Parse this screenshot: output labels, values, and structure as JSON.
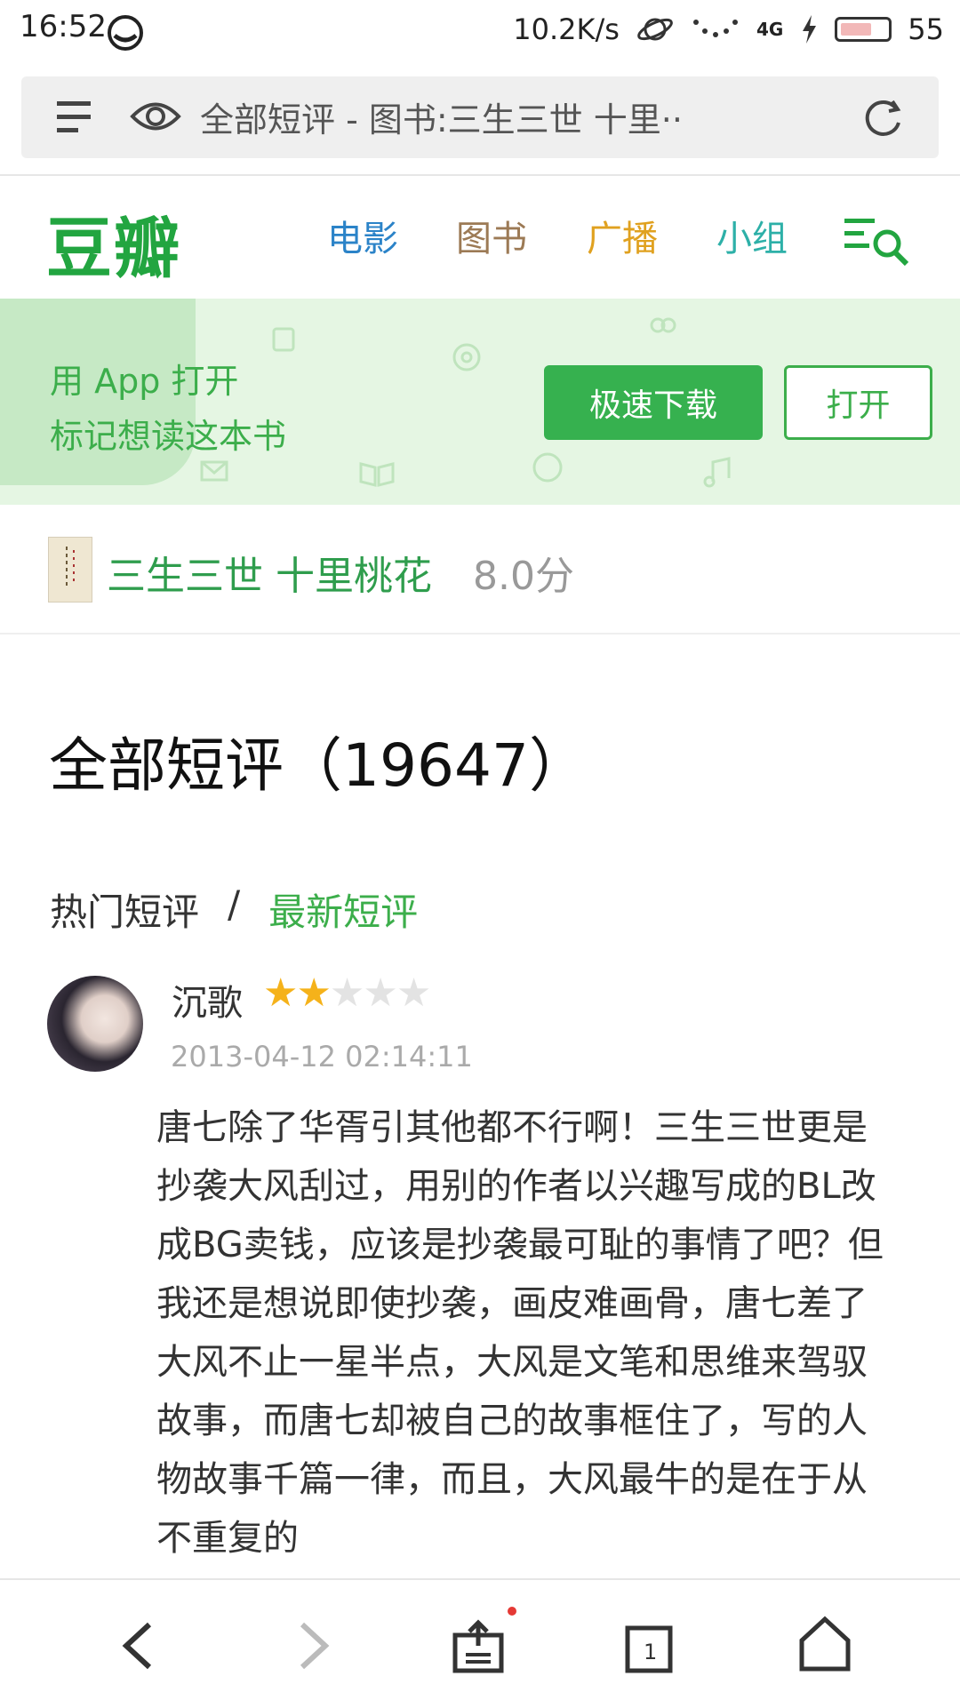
{
  "status_bar": {
    "time": "16:52",
    "speed": "10.2K/s",
    "network": "4G",
    "battery": "55"
  },
  "browser": {
    "page_title": "全部短评 - 图书:三生三世 十里··"
  },
  "douban_nav": {
    "logo": "豆瓣",
    "items": [
      "电影",
      "图书",
      "广播",
      "小组"
    ]
  },
  "app_banner": {
    "line1": "用 App 打开",
    "line2": "标记想读这本书",
    "download_label": "极速下载",
    "open_label": "打开"
  },
  "book": {
    "title": "三生三世 十里桃花",
    "score": "8.0分"
  },
  "heading": "全部短评（19647）",
  "tabs": {
    "hot": "热门短评",
    "separator": "/",
    "latest": "最新短评"
  },
  "review": {
    "user": "沉歌",
    "rating": 2,
    "rating_max": 5,
    "date": "2013-04-12 02:14:11",
    "text": "唐七除了华胥引其他都不行啊！三生三世更是抄袭大风刮过，用别的作者以兴趣写成的BL改成BG卖钱，应该是抄袭最可耻的事情了吧？但我还是想说即使抄袭，画皮难画骨，唐七差了大风不止一星半点，大风是文笔和思维来驾驭故事，而唐七却被自己的故事框住了，写的人物故事千篇一律，而且，大风最牛的是在于从不重复的"
  },
  "icons": {
    "accent": "#22a540"
  }
}
